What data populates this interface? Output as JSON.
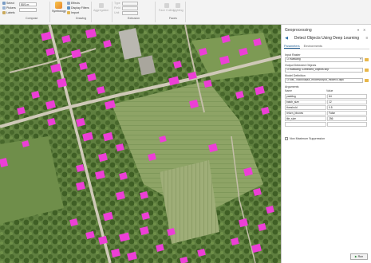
{
  "ribbon": {
    "compose": {
      "label": "Compose",
      "items": [
        "Select",
        "Pickers",
        "Labels"
      ],
      "scale": "50/1 m"
    },
    "drawing": {
      "label": "Drawing",
      "symbology": "Symbology",
      "items": [
        "Effects",
        "Display Filters",
        "Import"
      ]
    },
    "aggregation": {
      "label": "Aggregation"
    },
    "extrusion": {
      "label": "Extrusion",
      "items": [
        "Type",
        "Field",
        "Unit"
      ]
    },
    "faces": {
      "label": "Faces",
      "items": [
        "Face Culling",
        "Lighting"
      ]
    }
  },
  "pane": {
    "title": "Geoprocessing",
    "tool_title": "Detect Objects Using Deep Learning",
    "tabs": [
      "Parameters",
      "Environments"
    ],
    "input_raster_label": "Input Raster",
    "input_raster_value": "D:\\Mawang",
    "output_label": "Output Detected Objects",
    "output_value": "D:\\Mawang..\\Detected_objects.shp",
    "model_def_label": "Model Definition",
    "model_def_value": "D:\\usr_7688\\output_model\\output_model\\4.dlpk",
    "arguments_label": "Arguments",
    "arg_headers": [
      "Name",
      "Value"
    ],
    "args": [
      {
        "name": "padding",
        "value": "64"
      },
      {
        "name": "batch_size",
        "value": "12"
      },
      {
        "name": "threshold",
        "value": "0.5"
      },
      {
        "name": "return_bboxes",
        "value": "False"
      },
      {
        "name": "tile_size",
        "value": "256"
      }
    ],
    "nms_label": "Non Maximum Suppression",
    "run_label": "Run"
  },
  "colors": {
    "building": "#ec3fd6",
    "road": "#cfc9b8",
    "ribbon_bg": "#f3f3f3",
    "accent": "#1c5b91"
  }
}
